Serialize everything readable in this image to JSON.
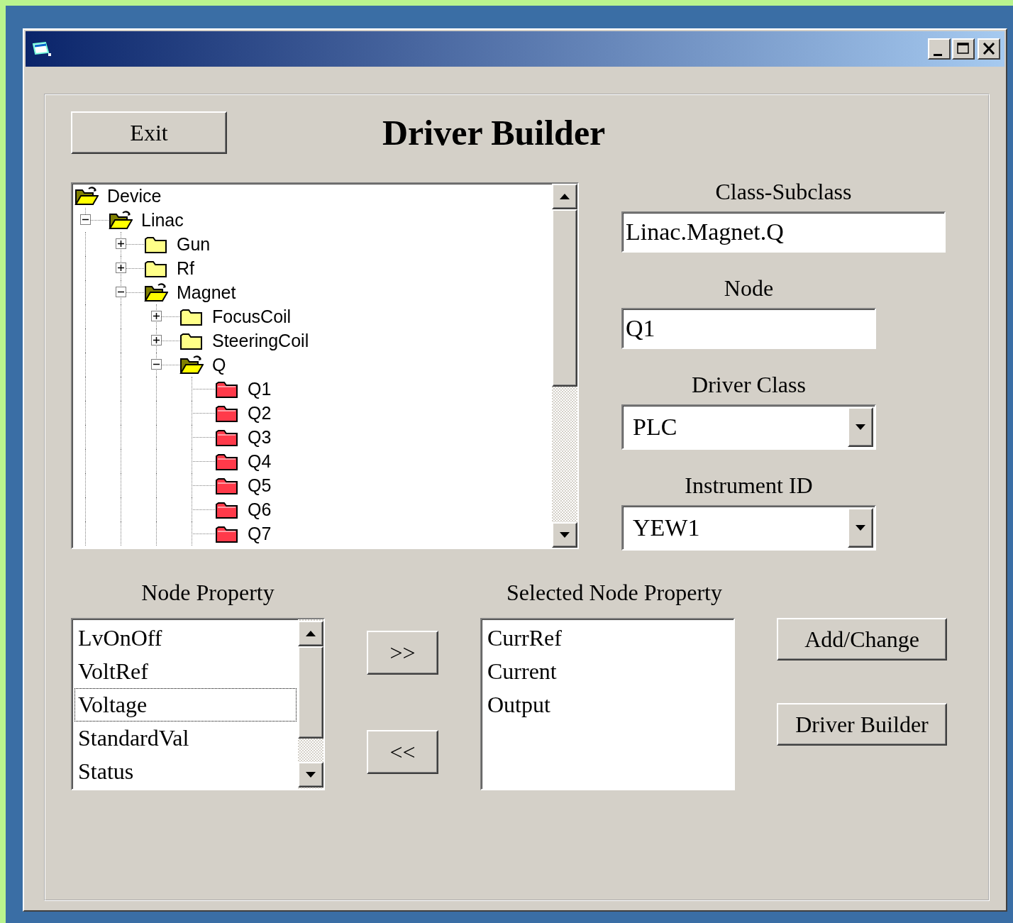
{
  "header": {
    "exit_button": "Exit",
    "title": "Driver Builder"
  },
  "tree": {
    "items": [
      {
        "label": "Device",
        "kind": "root",
        "expanded": true,
        "children": [
          {
            "label": "Linac",
            "kind": "branch",
            "expanded": true,
            "children": [
              {
                "label": "Gun",
                "kind": "branch",
                "expanded": false
              },
              {
                "label": "Rf",
                "kind": "branch",
                "expanded": false
              },
              {
                "label": "Magnet",
                "kind": "branch",
                "expanded": true,
                "children": [
                  {
                    "label": "FocusCoil",
                    "kind": "branch",
                    "expanded": false
                  },
                  {
                    "label": "SteeringCoil",
                    "kind": "branch",
                    "expanded": false
                  },
                  {
                    "label": "Q",
                    "kind": "branch",
                    "expanded": true,
                    "children": [
                      {
                        "label": "Q1",
                        "kind": "leaf"
                      },
                      {
                        "label": "Q2",
                        "kind": "leaf"
                      },
                      {
                        "label": "Q3",
                        "kind": "leaf"
                      },
                      {
                        "label": "Q4",
                        "kind": "leaf"
                      },
                      {
                        "label": "Q5",
                        "kind": "leaf"
                      },
                      {
                        "label": "Q6",
                        "kind": "leaf"
                      },
                      {
                        "label": "Q7",
                        "kind": "leaf"
                      }
                    ]
                  }
                ]
              }
            ]
          }
        ]
      }
    ]
  },
  "fields": [
    {
      "label": "Class-Subclass",
      "value": "Linac.Magnet.Q",
      "kind": "text"
    },
    {
      "label": "Node",
      "value": "Q1",
      "kind": "text"
    },
    {
      "label": "Driver Class",
      "value": "PLC",
      "kind": "combo"
    },
    {
      "label": "Instrument ID",
      "value": "YEW1",
      "kind": "combo"
    }
  ],
  "node_property": {
    "label": "Node Property",
    "items": [
      {
        "label": "LvOnOff",
        "focused": false
      },
      {
        "label": "VoltRef",
        "focused": false
      },
      {
        "label": "Voltage",
        "focused": true
      },
      {
        "label": "StandardVal",
        "focused": false
      },
      {
        "label": "Status",
        "focused": false
      }
    ]
  },
  "move_buttons": [
    ">>",
    "<<"
  ],
  "selected_node_property": {
    "label": "Selected Node Property",
    "items": [
      "CurrRef",
      "Current",
      "Output"
    ]
  },
  "action_buttons": [
    "Add/Change",
    "Driver Builder"
  ]
}
